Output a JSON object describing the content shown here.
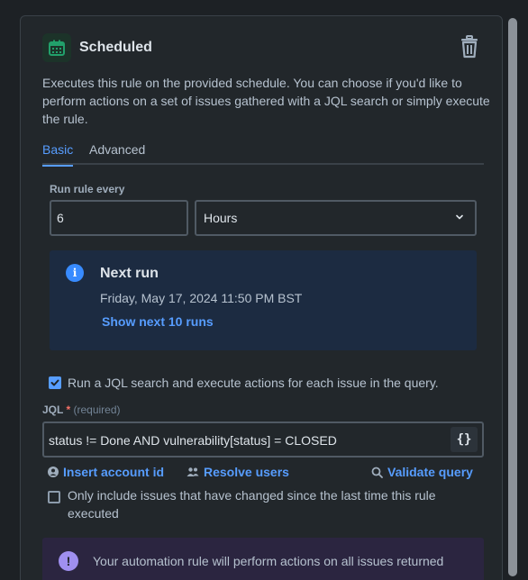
{
  "header": {
    "title": "Scheduled"
  },
  "description": "Executes this rule on the provided schedule. You can choose if you'd like to perform actions on a set of issues gathered with a JQL search or simply execute the rule.",
  "tabs": [
    {
      "label": "Basic"
    },
    {
      "label": "Advanced"
    }
  ],
  "run_rule": {
    "label": "Run rule every",
    "value": "6",
    "unit": "Hours"
  },
  "next_run": {
    "title": "Next run",
    "date": "Friday, May 17, 2024 11:50 PM BST",
    "link": "Show next 10 runs"
  },
  "jql_search": {
    "checkbox_label": "Run a JQL search and execute actions for each issue in the query.",
    "checked": true
  },
  "jql": {
    "label": "JQL",
    "required_star": "*",
    "required_text": "(required)",
    "value": "status != Done AND vulnerability[status] = CLOSED",
    "braces": "{}"
  },
  "jql_actions": {
    "insert": "Insert account id",
    "resolve": "Resolve users",
    "validate": "Validate query"
  },
  "changed_only": {
    "label": "Only include issues that have changed since the last time this rule executed",
    "checked": false
  },
  "warning": {
    "icon": "!",
    "text": "Your automation rule will perform actions on all issues returned"
  },
  "colors": {
    "accent": "#579dff",
    "header_icon": "#22a06b",
    "info_bg": "#1c2b41",
    "warning_icon": "#9f8fef"
  }
}
